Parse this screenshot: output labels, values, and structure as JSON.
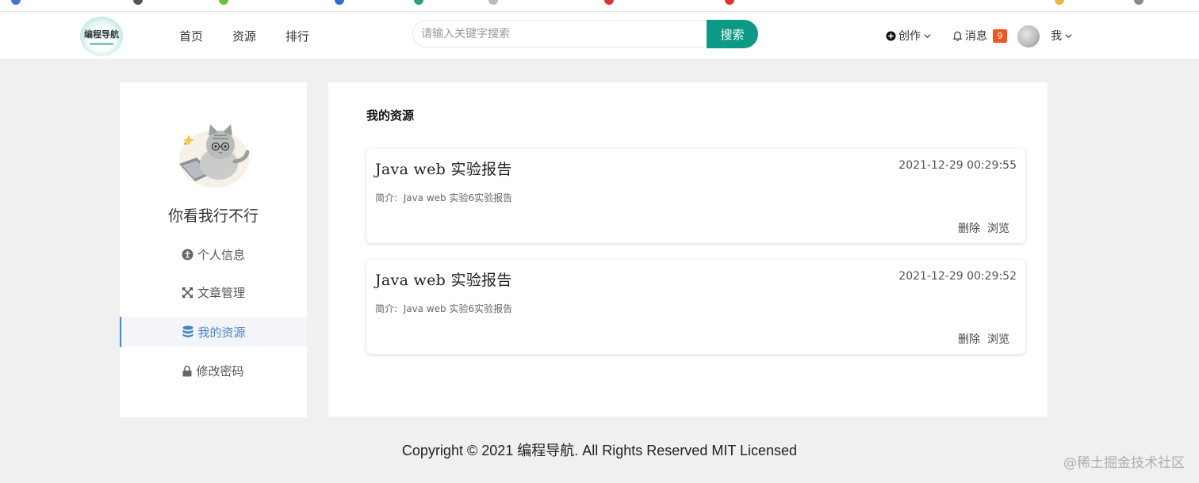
{
  "header": {
    "logo_text": "编程导航",
    "nav": [
      "首页",
      "资源",
      "排行"
    ],
    "search_placeholder": "请输入关键字搜索",
    "search_button": "搜索",
    "create_label": "创作",
    "messages_label": "消息",
    "messages_count": "9",
    "me_label": "我"
  },
  "profile": {
    "username": "你看我行不行",
    "menu": [
      {
        "label": "个人信息",
        "icon": "info-icon"
      },
      {
        "label": "文章管理",
        "icon": "expand-icon"
      },
      {
        "label": "我的资源",
        "icon": "database-icon",
        "active": true
      },
      {
        "label": "修改密码",
        "icon": "lock-icon"
      }
    ]
  },
  "main": {
    "section_title": "我的资源",
    "resources": [
      {
        "title": "Java web 实验报告",
        "time": "2021-12-29 00:29:55",
        "desc_label": "简介:",
        "desc": "Java web 实验6实验报告",
        "delete": "删除",
        "view": "浏览"
      },
      {
        "title": "Java web 实验报告",
        "time": "2021-12-29 00:29:52",
        "desc_label": "简介:",
        "desc": "Java web 实验6实验报告",
        "delete": "删除",
        "view": "浏览"
      }
    ]
  },
  "footer": {
    "copyright": "Copyright © 2021 编程导航. All Rights Reserved MIT Licensed"
  },
  "watermark": "@稀土掘金技术社区",
  "colors": {
    "accent": "#0c9a86",
    "badge": "#f0561f",
    "active_menu": "#4a84c9",
    "page_bg": "#f0f0f0"
  }
}
